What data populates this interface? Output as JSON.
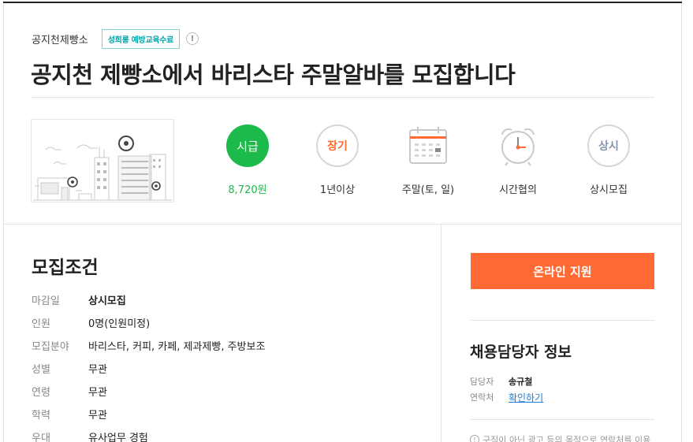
{
  "header": {
    "company_name": "공지천제빵소",
    "badge": "성희롱 예방교육수료",
    "info_icon": "!",
    "title": "공지천 제빵소에서 바리스타 주말알바를 모집합니다"
  },
  "stats": {
    "wage": {
      "circle": "시급",
      "label": "8,720원",
      "icon": "wage-circle"
    },
    "period": {
      "circle": "장기",
      "label": "1년이상",
      "icon": "long-term-circle"
    },
    "days": {
      "label": "주말(토, 일)",
      "icon": "calendar-icon"
    },
    "time": {
      "label": "시간협의",
      "icon": "alarm-clock-icon"
    },
    "deadline": {
      "circle": "상시",
      "label": "상시모집",
      "icon": "always-circle"
    }
  },
  "conditions": {
    "title": "모집조건",
    "rows": [
      {
        "key": "마감일",
        "value": "상시모집"
      },
      {
        "key": "인원",
        "value": "0명(인원미정)"
      },
      {
        "key": "모집분야",
        "value": "바리스타, 커피, 카페, 제과제빵, 주방보조"
      },
      {
        "key": "성별",
        "value": "무관"
      },
      {
        "key": "연령",
        "value": "무관"
      },
      {
        "key": "학력",
        "value": "무관"
      },
      {
        "key": "우대",
        "value": "유사업무 경험"
      }
    ]
  },
  "sidebar": {
    "apply_button": "온라인 지원",
    "contact_title": "채용담당자 정보",
    "manager_key": "담당자",
    "manager_value": "송규철",
    "phone_key": "연락처",
    "phone_link": "확인하기",
    "notice": "구직이 아닌 광고 등의 목적으로 연락처를 이용"
  },
  "colors": {
    "accent": "#ff6a35",
    "green": "#1cb94b",
    "badge": "#00a5a8",
    "link": "#1a7cd8"
  }
}
